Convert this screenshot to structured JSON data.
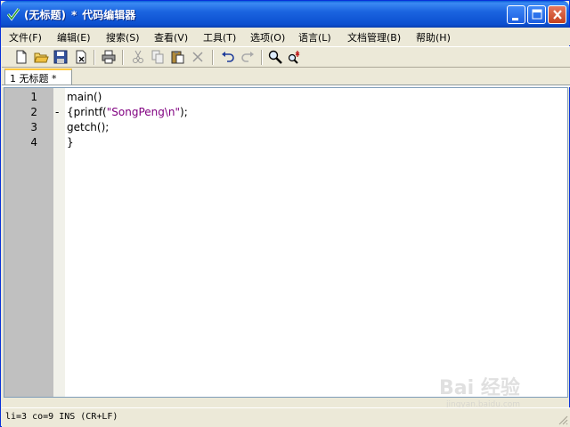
{
  "window": {
    "title_doc": "(无标题)",
    "title_sep": "*",
    "title_app": "代码编辑器"
  },
  "menu": [
    {
      "label": "文件(F)"
    },
    {
      "label": "编辑(E)"
    },
    {
      "label": "搜索(S)"
    },
    {
      "label": "查看(V)"
    },
    {
      "label": "工具(T)"
    },
    {
      "label": "选项(O)"
    },
    {
      "label": "语言(L)"
    },
    {
      "label": "文档管理(B)"
    },
    {
      "label": "帮助(H)"
    }
  ],
  "toolbar": {
    "icons": [
      "new-file-icon",
      "open-folder-icon",
      "save-icon",
      "close-file-icon",
      "print-icon",
      "cut-icon",
      "copy-icon",
      "paste-icon",
      "delete-icon",
      "undo-icon",
      "redo-icon",
      "find-icon",
      "replace-icon"
    ]
  },
  "tab": {
    "label": "1 无标题 *"
  },
  "editor": {
    "line_numbers": [
      "1",
      "2",
      "3",
      "4"
    ],
    "fold_marker": "-",
    "lines": [
      {
        "before": "main()",
        "string": "",
        "after": ""
      },
      {
        "before": "{printf(",
        "string": "\"SongPeng\\n\"",
        "after": ");"
      },
      {
        "before": "getch();",
        "string": "",
        "after": ""
      },
      {
        "before": "}",
        "string": "",
        "after": ""
      }
    ],
    "string_color": "#800080"
  },
  "status": {
    "text": "li=3 co=9 INS (CR+LF)"
  },
  "watermark": {
    "main": "Bai 经验",
    "sub": "jingyan.baidu.com"
  }
}
